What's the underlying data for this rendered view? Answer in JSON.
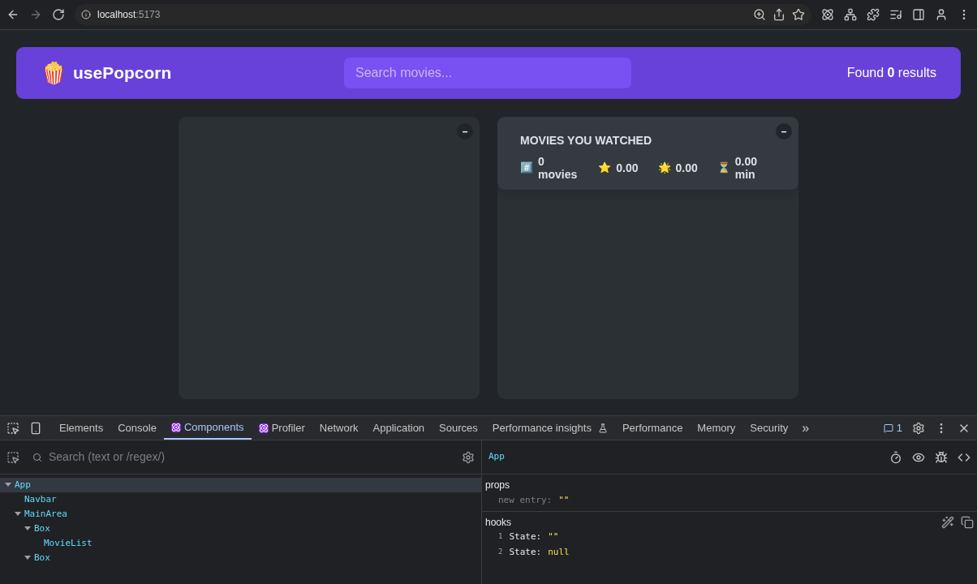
{
  "browser": {
    "url_host": "localhost",
    "url_port": ":5173"
  },
  "app": {
    "logo_emoji": "🍿",
    "title": "usePopcorn",
    "search": {
      "placeholder": "Search movies..."
    },
    "results": "Found **0** results",
    "boxes": [
      {
        "kind": "list",
        "toggle": "–"
      },
      {
        "kind": "watched",
        "toggle": "–",
        "summary": {
          "heading": "MOVIES YOU WATCHED",
          "stats": [
            {
              "emoji": "#️⃣",
              "text": "0 movies"
            },
            {
              "emoji": "⭐️",
              "text": "0.00"
            },
            {
              "emoji": "🌟",
              "text": "0.00"
            },
            {
              "emoji": "⏳",
              "text": "0.00 min"
            }
          ]
        }
      }
    ]
  },
  "devtools": {
    "tabs": [
      {
        "label": "Elements",
        "selected": false,
        "kind": "plain"
      },
      {
        "label": "Console",
        "selected": false,
        "kind": "plain"
      },
      {
        "label": "Components",
        "selected": true,
        "kind": "react"
      },
      {
        "label": "Profiler",
        "selected": false,
        "kind": "react"
      },
      {
        "label": "Network",
        "selected": false,
        "kind": "plain"
      },
      {
        "label": "Application",
        "selected": false,
        "kind": "plain"
      },
      {
        "label": "Sources",
        "selected": false,
        "kind": "plain"
      },
      {
        "label": "Performance insights",
        "selected": false,
        "kind": "flask"
      },
      {
        "label": "Performance",
        "selected": false,
        "kind": "plain"
      },
      {
        "label": "Memory",
        "selected": false,
        "kind": "plain"
      },
      {
        "label": "Security",
        "selected": false,
        "kind": "plain"
      }
    ],
    "more": "»",
    "issues": "1",
    "search": {
      "placeholder": "Search (text or /regex/)"
    },
    "tree": [
      {
        "name": "App",
        "selected": true,
        "expanded": true,
        "children": [
          {
            "name": "Navbar",
            "selected": false,
            "expanded": false
          },
          {
            "name": "MainArea",
            "selected": false,
            "expanded": true,
            "children": [
              {
                "name": "Box",
                "selected": false,
                "expanded": true,
                "children": [
                  {
                    "name": "MovieList",
                    "selected": false,
                    "expanded": false
                  }
                ]
              },
              {
                "name": "Box",
                "selected": false,
                "expanded": true
              }
            ]
          }
        ]
      }
    ],
    "inspector": {
      "component": "App",
      "props": {
        "title": "props",
        "entries": [
          {
            "key": "new entry:",
            "value": "\"\""
          }
        ]
      },
      "hooks": {
        "title": "hooks",
        "entries": [
          {
            "index": "1",
            "key": "State:",
            "value": "\"\""
          },
          {
            "index": "2",
            "key": "State:",
            "value": "null"
          }
        ]
      }
    }
  }
}
